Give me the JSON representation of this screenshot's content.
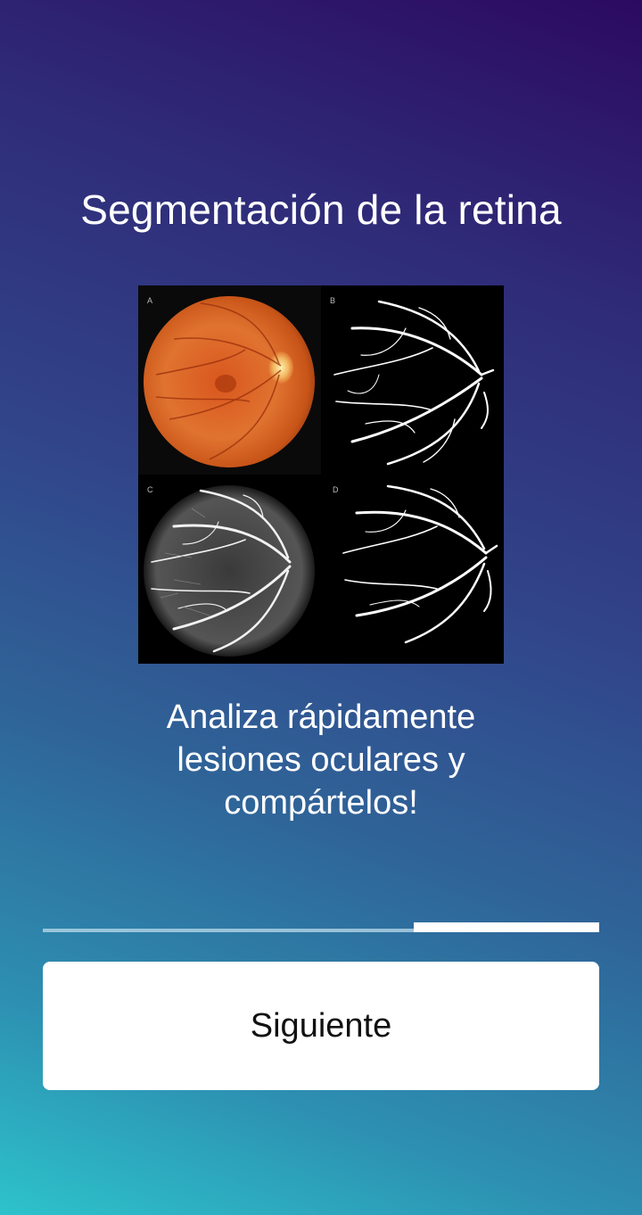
{
  "onboarding": {
    "title": "Segmentación de la retina",
    "description": "Analiza rápidamente lesiones oculares y compártelos!",
    "image": {
      "panels": [
        {
          "label": "A"
        },
        {
          "label": "B"
        },
        {
          "label": "C"
        },
        {
          "label": "D"
        }
      ]
    },
    "progress": {
      "current_step": 3,
      "total_steps": 3
    },
    "next_button_label": "Siguiente"
  }
}
